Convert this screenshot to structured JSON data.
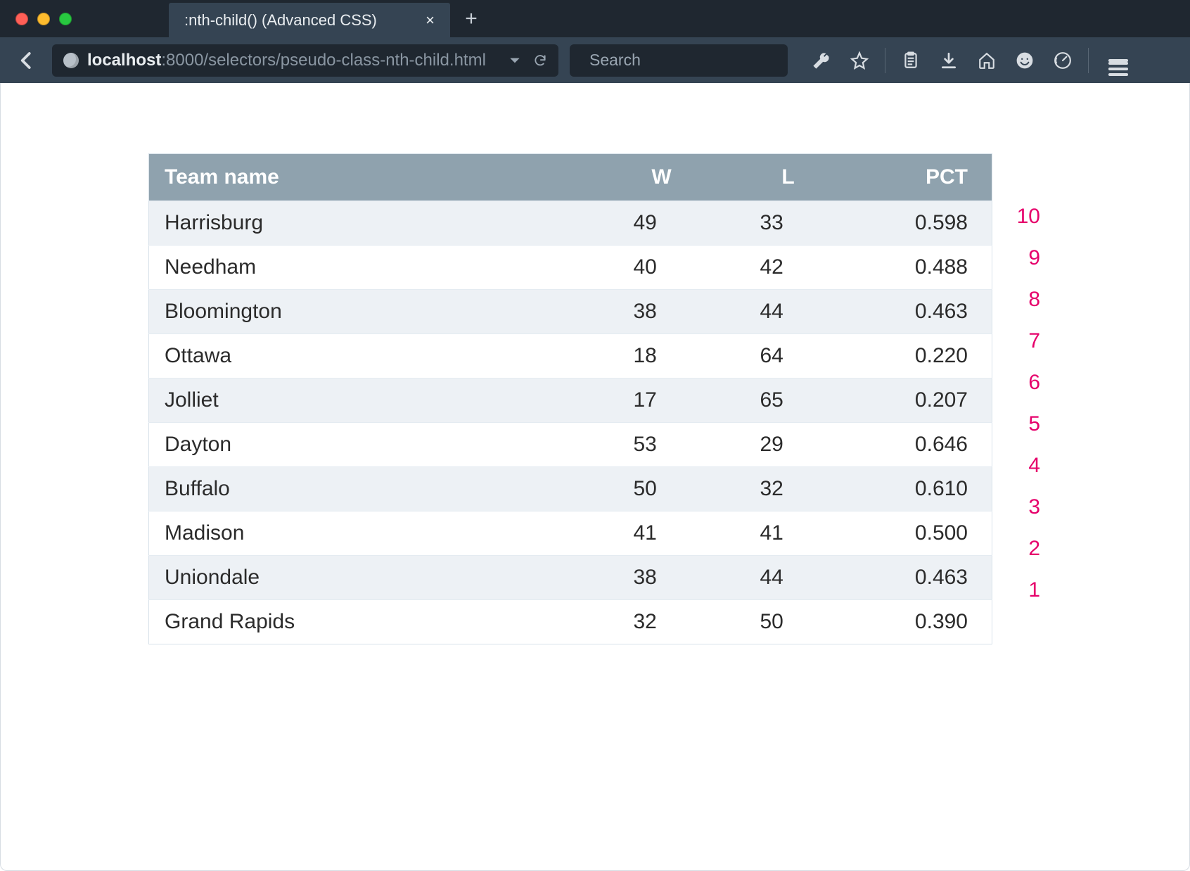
{
  "browser": {
    "tab_title": ":nth-child() (Advanced CSS)",
    "url_host": "localhost",
    "url_path": ":8000/selectors/pseudo-class-nth-child.html",
    "search_placeholder": "Search"
  },
  "table": {
    "headers": {
      "team": "Team name",
      "w": "W",
      "l": "L",
      "pct": "PCT"
    },
    "rows": [
      {
        "team": "Harrisburg",
        "w": "49",
        "l": "33",
        "pct": "0.598",
        "idx": "10"
      },
      {
        "team": "Needham",
        "w": "40",
        "l": "42",
        "pct": "0.488",
        "idx": "9"
      },
      {
        "team": "Bloomington",
        "w": "38",
        "l": "44",
        "pct": "0.463",
        "idx": "8"
      },
      {
        "team": "Ottawa",
        "w": "18",
        "l": "64",
        "pct": "0.220",
        "idx": "7"
      },
      {
        "team": "Jolliet",
        "w": "17",
        "l": "65",
        "pct": "0.207",
        "idx": "6"
      },
      {
        "team": "Dayton",
        "w": "53",
        "l": "29",
        "pct": "0.646",
        "idx": "5"
      },
      {
        "team": "Buffalo",
        "w": "50",
        "l": "32",
        "pct": "0.610",
        "idx": "4"
      },
      {
        "team": "Madison",
        "w": "41",
        "l": "41",
        "pct": "0.500",
        "idx": "3"
      },
      {
        "team": "Uniondale",
        "w": "38",
        "l": "44",
        "pct": "0.463",
        "idx": "2"
      },
      {
        "team": "Grand Rapids",
        "w": "32",
        "l": "50",
        "pct": "0.390",
        "idx": "1"
      }
    ]
  }
}
